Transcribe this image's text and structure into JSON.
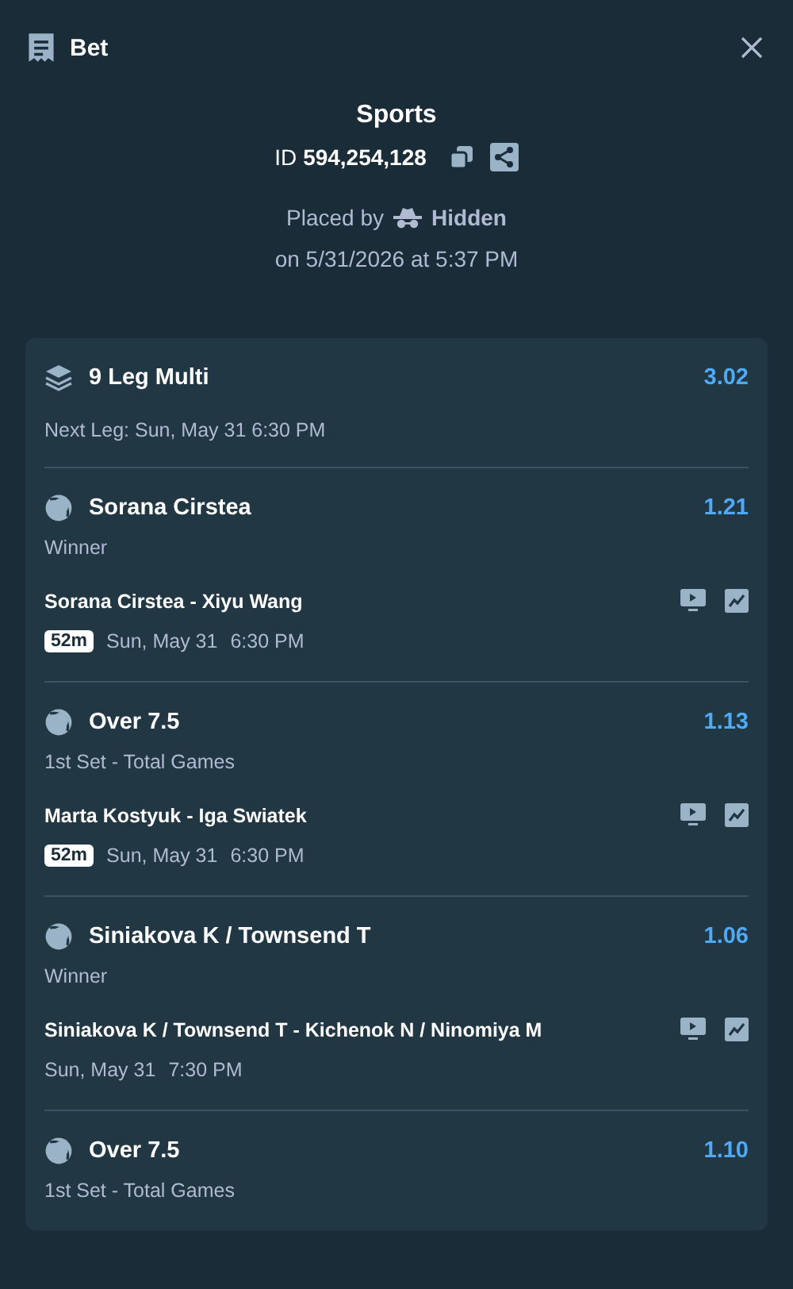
{
  "header": {
    "title": "Bet"
  },
  "summary": {
    "title": "Sports",
    "id_label": "ID",
    "id_value": "594,254,128",
    "placed_by_label": "Placed by",
    "placed_by_user": "Hidden",
    "placed_on": "on 5/31/2026 at 5:37 PM"
  },
  "multi": {
    "title": "9 Leg Multi",
    "odds": "3.02",
    "next_leg": "Next Leg: Sun, May 31 6:30 PM"
  },
  "legs": [
    {
      "selection": "Sorana Cirstea",
      "odds": "1.21",
      "market": "Winner",
      "event": "Sorana Cirstea - Xiyu Wang",
      "badge": "52m",
      "date": "Sun, May 31",
      "time": "6:30 PM"
    },
    {
      "selection": "Over 7.5",
      "odds": "1.13",
      "market": "1st Set - Total Games",
      "event": "Marta Kostyuk - Iga Swiatek",
      "badge": "52m",
      "date": "Sun, May 31",
      "time": "6:30 PM"
    },
    {
      "selection": "Siniakova K / Townsend T",
      "odds": "1.06",
      "market": "Winner",
      "event": "Siniakova K / Townsend T - Kichenok N / Ninomiya M",
      "date": "Sun, May 31",
      "time": "7:30 PM"
    },
    {
      "selection": "Over 7.5",
      "odds": "1.10",
      "market": "1st Set - Total Games"
    }
  ]
}
